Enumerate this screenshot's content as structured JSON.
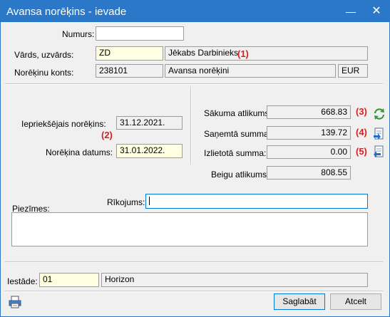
{
  "window": {
    "title": "Avansa norēķins - ievade",
    "minimize": "—",
    "close": "✕"
  },
  "header": {
    "numurs_label": "Numurs:",
    "numurs_value": "",
    "vards_label": "Vārds, uzvārds:",
    "vards_code": "ZD",
    "vards_name": "Jēkabs Darbinieks",
    "konts_label": "Norēķinu konts:",
    "konts_code": "238101",
    "konts_name": "Avansa norēķini",
    "konts_currency": "EUR"
  },
  "dates": {
    "ieprieksejais_label": "Iepriekšējais norēķins:",
    "ieprieksejais_value": "31.12.2021.",
    "datums_label": "Norēķina datums:",
    "datums_value": "31.01.2022."
  },
  "sums": {
    "sakuma_label": "Sākuma atlikums:",
    "sakuma_value": "668.83",
    "sanemta_label": "Saņemtā summa:",
    "sanemta_value": "139.72",
    "izlietota_label": "Izlietotā summa:",
    "izlietota_value": "0.00",
    "beigu_label": "Beigu atlikums:",
    "beigu_value": "808.55"
  },
  "markers": [
    "(1)",
    "(2)",
    "(3)",
    "(4)",
    "(5)"
  ],
  "notes": {
    "rikojums_label": "Rīkojums:",
    "rikojums_value": "",
    "piezimes_label": "Piezīmes:",
    "piezimes_value": ""
  },
  "footer": {
    "iestade_label": "Iestāde:",
    "iestade_code": "01",
    "iestade_name": "Horizon",
    "save_label": "Saglabāt",
    "cancel_label": "Atcelt"
  },
  "icons": {
    "refresh": "refresh-icon",
    "doc_in": "document-import-icon",
    "doc_out": "document-export-icon",
    "print": "printer-icon"
  },
  "colors": {
    "titlebar": "#2b78c8",
    "marker": "#d62020",
    "yellow_field": "#ffffe1"
  }
}
